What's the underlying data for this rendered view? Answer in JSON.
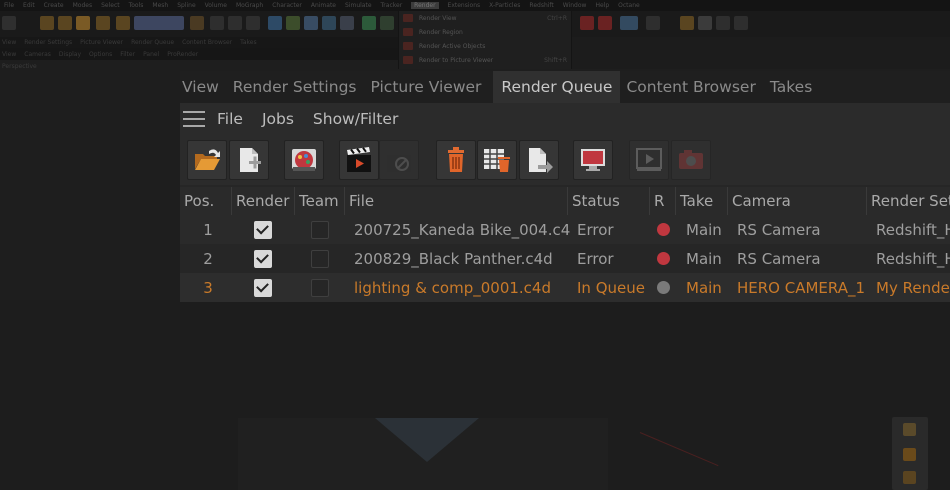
{
  "colors": {
    "error_dot": "#c0373f",
    "queued_dot": "#7a7a7a",
    "queued_text": "#c97a2a",
    "active_tab_bg": "#303030"
  },
  "tabs": [
    {
      "label": "View",
      "active": false
    },
    {
      "label": "Render Settings",
      "active": false
    },
    {
      "label": "Picture Viewer",
      "active": false
    },
    {
      "label": "Render Queue",
      "active": true
    },
    {
      "label": "Content Browser",
      "active": false
    },
    {
      "label": "Takes",
      "active": false
    }
  ],
  "menu": {
    "icon": "hamburger-menu-icon",
    "items": [
      "File",
      "Jobs",
      "Show/Filter"
    ]
  },
  "toolbar": {
    "buttons": [
      {
        "icon": "open-folder-icon",
        "enabled": true
      },
      {
        "icon": "add-file-icon",
        "enabled": true
      },
      {
        "icon": "render-settings-palette-icon",
        "enabled": true
      },
      {
        "icon": "start-render-clapper-icon",
        "enabled": true
      },
      {
        "icon": "stop-render-icon",
        "enabled": false
      },
      {
        "icon": "delete-trash-icon",
        "enabled": true
      },
      {
        "icon": "delete-all-table-icon",
        "enabled": true
      },
      {
        "icon": "export-file-icon",
        "enabled": true
      },
      {
        "icon": "monitor-view-icon",
        "enabled": true
      },
      {
        "icon": "picture-viewer-icon",
        "enabled": false
      },
      {
        "icon": "camera-record-icon",
        "enabled": false
      }
    ]
  },
  "table": {
    "columns": {
      "pos": "Pos.",
      "render": "Render",
      "team": "Team",
      "file": "File",
      "status": "Status",
      "r": "R",
      "take": "Take",
      "camera": "Camera",
      "render_settings": "Render Set"
    },
    "rows": [
      {
        "pos": "1",
        "render": true,
        "team": false,
        "file": "200725_Kaneda Bike_004.c4d",
        "status": "Error",
        "r": "error",
        "take": "Main",
        "camera": "RS Camera",
        "render_settings": "Redshift_H"
      },
      {
        "pos": "2",
        "render": true,
        "team": false,
        "file": "200829_Black Panther.c4d",
        "status": "Error",
        "r": "error",
        "take": "Main",
        "camera": "RS Camera",
        "render_settings": "Redshift_H"
      },
      {
        "pos": "3",
        "render": true,
        "team": false,
        "file": "lighting & comp_0001.c4d",
        "status": "In Queue",
        "r": "queued",
        "take": "Main",
        "camera": "HERO CAMERA_1",
        "render_settings": "My Rende"
      }
    ]
  }
}
